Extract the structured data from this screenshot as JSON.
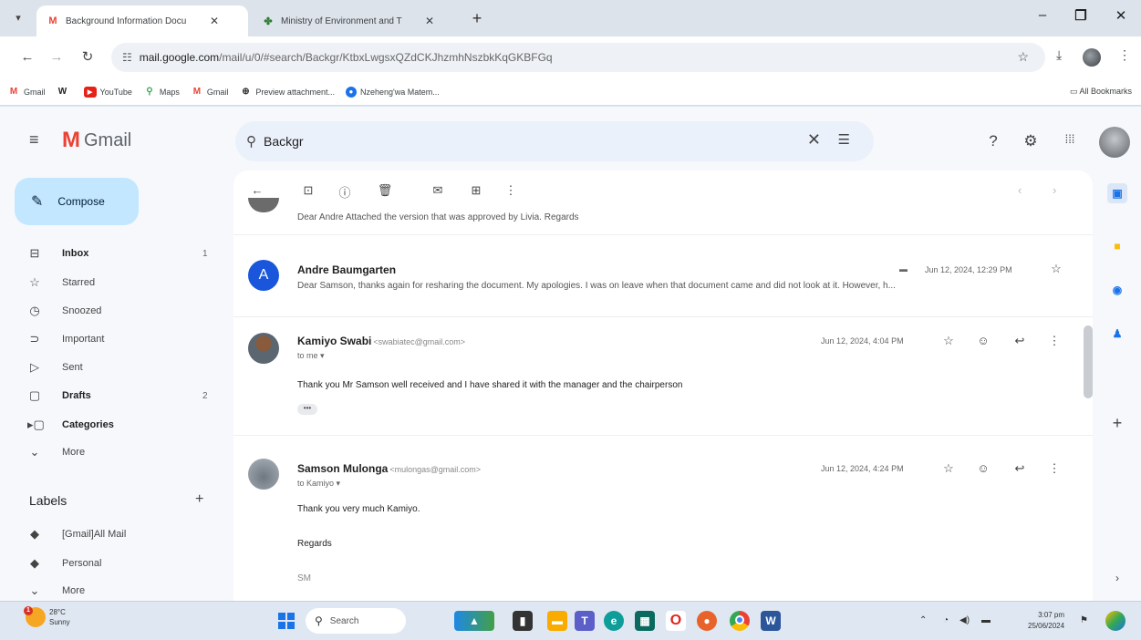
{
  "browser": {
    "tabs": [
      {
        "label": "Background Information Docu",
        "favicon": "gmail-icon",
        "active": true
      },
      {
        "label": "Ministry of Environment and T",
        "favicon": "ministry-icon",
        "active": false
      }
    ],
    "url_host": "mail.google.com",
    "url_path": "/mail/u/0/#search/Backgr/KtbxLwgsxQZdCKJhzmhNszbkKqGKBFGq",
    "bookmarks": [
      {
        "label": "Gmail",
        "icon": "gmail-icon"
      },
      {
        "label": "",
        "icon": "wikipedia-icon"
      },
      {
        "label": "YouTube",
        "icon": "youtube-icon"
      },
      {
        "label": "Maps",
        "icon": "maps-icon"
      },
      {
        "label": "Gmail",
        "icon": "gmail-icon"
      },
      {
        "label": "Preview attachment...",
        "icon": "globe-icon"
      },
      {
        "label": "Nzeheng'wa Matem...",
        "icon": "blue-circle-icon"
      }
    ],
    "all_bookmarks": "All Bookmarks"
  },
  "gmail": {
    "brand": "Gmail",
    "search_value": "Backgr",
    "compose_label": "Compose",
    "nav": [
      {
        "label": "Inbox",
        "icon": "inbox-icon",
        "count": "1",
        "bold": true
      },
      {
        "label": "Starred",
        "icon": "star-icon",
        "count": "",
        "bold": false
      },
      {
        "label": "Snoozed",
        "icon": "clock-icon",
        "count": "",
        "bold": false
      },
      {
        "label": "Important",
        "icon": "important-icon",
        "count": "",
        "bold": false
      },
      {
        "label": "Sent",
        "icon": "send-icon",
        "count": "",
        "bold": false
      },
      {
        "label": "Drafts",
        "icon": "draft-icon",
        "count": "2",
        "bold": true
      },
      {
        "label": "Categories",
        "icon": "category-icon",
        "count": "",
        "bold": true
      },
      {
        "label": "More",
        "icon": "chevron-down-icon",
        "count": "",
        "bold": false
      }
    ],
    "labels_title": "Labels",
    "labels": [
      {
        "label": "[Gmail]All Mail",
        "icon": "label-icon"
      },
      {
        "label": "Personal",
        "icon": "label-icon"
      },
      {
        "label": "More",
        "icon": "chevron-down-icon"
      }
    ]
  },
  "thread": {
    "collapsed_snippet": "Dear Andre Attached the version that was approved by Livia. Regards",
    "messages": [
      {
        "sender": "Andre Baumgarten",
        "email": "",
        "avatar_letter": "A",
        "date": "Jun 12, 2024, 12:29 PM",
        "snippet": "Dear Samson, thanks again for resharing the document. My apologies. I was on leave when that document came and did not look at it. However, h..."
      },
      {
        "sender": "Kamiyo Swabi",
        "email": "<swabiatec@gmail.com>",
        "to": "to me",
        "date": "Jun 12, 2024, 4:04 PM",
        "body": "Thank you Mr Samson well received and I have shared it with the manager and the chairperson"
      },
      {
        "sender": "Samson Mulonga",
        "email": "<mulongas@gmail.com>",
        "to": "to Kamiyo",
        "date": "Jun 12, 2024, 4:24 PM",
        "body1": "Thank you very much Kamiyo.",
        "body2": "Regards",
        "body3": "SM"
      }
    ]
  },
  "taskbar": {
    "temp": "28°C",
    "weather": "Sunny",
    "weather_badge": "1",
    "search": "Search",
    "time": "3:07 pm",
    "date": "25/06/2024"
  }
}
